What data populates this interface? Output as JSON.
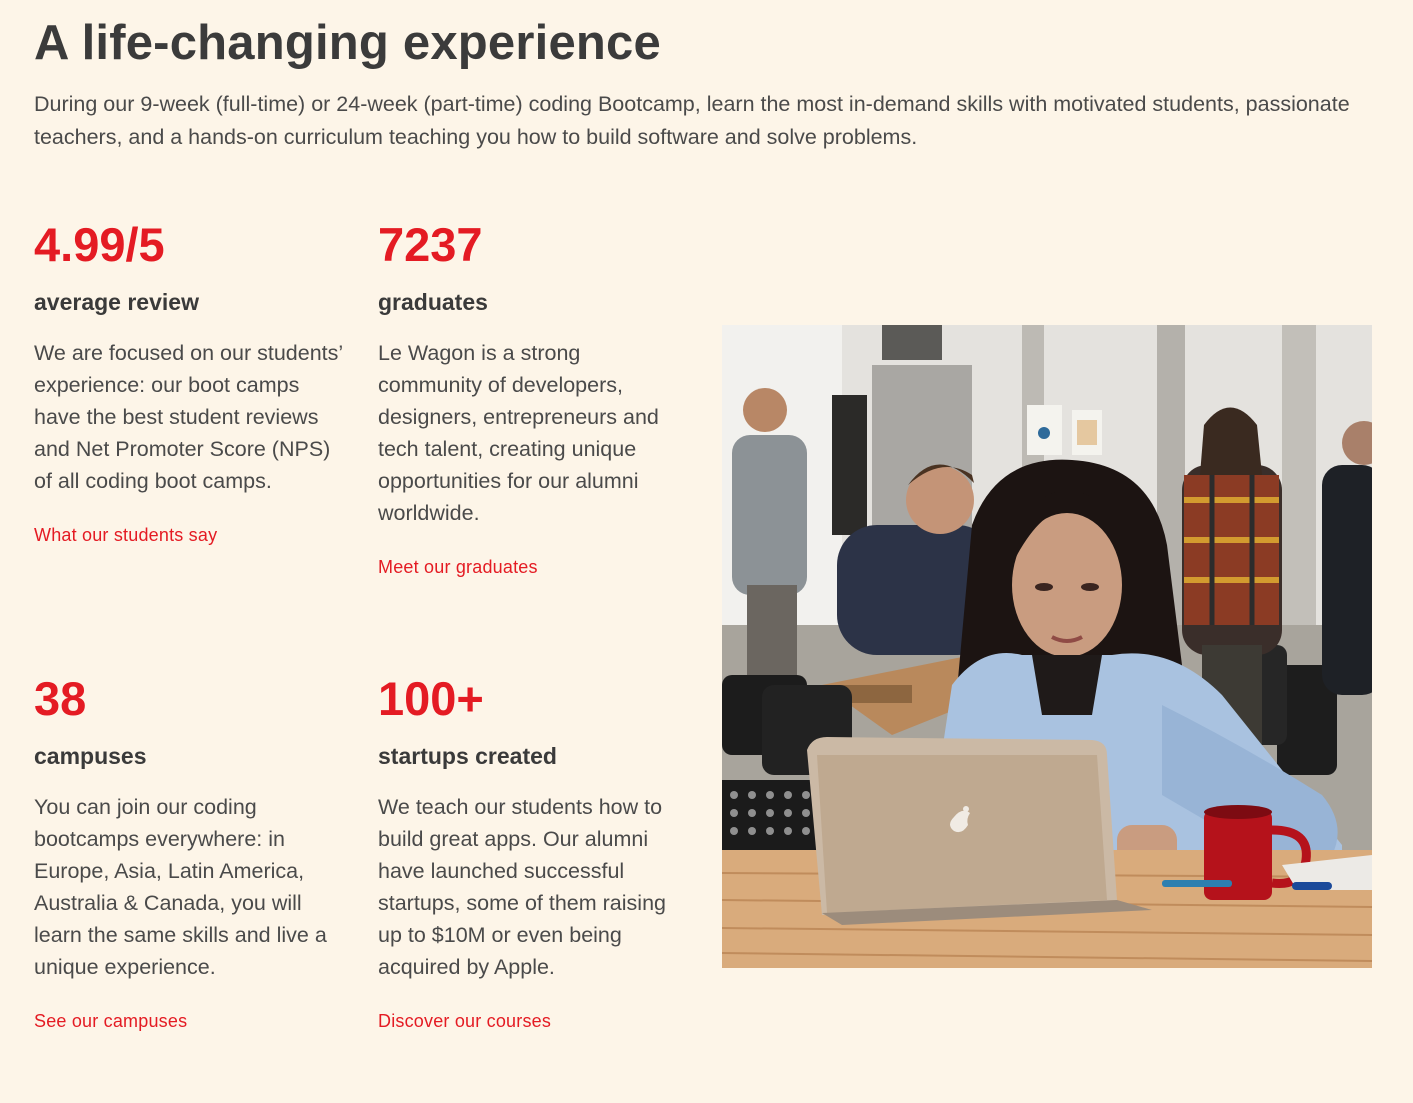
{
  "heading": "A life-changing experience",
  "intro": "During our 9-week (full-time) or 24-week (part-time) coding Bootcamp, learn the most in-demand skills with motivated students, passionate teachers, and a hands-on curriculum teaching you how to build software and solve problems.",
  "stats": [
    {
      "value": "4.99/5",
      "label": "average review",
      "description": "We are focused on our students’ experience: our boot camps have the best student reviews and Net Promoter Score (NPS) of all coding boot camps.",
      "link": "What our students say"
    },
    {
      "value": "7237",
      "label": "graduates",
      "description": "Le Wagon is a strong community of developers, designers, entrepreneurs and tech talent, creating unique opportunities for our alumni worldwide.",
      "link": "Meet our graduates"
    },
    {
      "value": "38",
      "label": "campuses",
      "description": "You can join our coding bootcamps everywhere: in Europe, Asia, Latin America, Australia & Canada, you will learn the same skills and live a unique experience.",
      "link": "See our campuses"
    },
    {
      "value": "100+",
      "label": "startups created",
      "description": "We teach our students how to build great apps. Our alumni have launched successful startups, some of them raising up to $10M or even being acquired by Apple.",
      "link": "Discover our courses"
    }
  ],
  "colors": {
    "background": "#fdf5e8",
    "accent": "#e41b23",
    "text": "#3a3a3a"
  }
}
